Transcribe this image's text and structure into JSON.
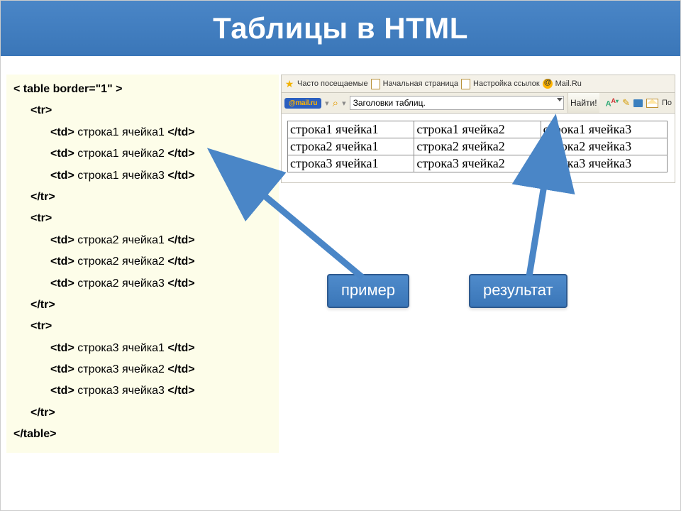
{
  "title": "Таблицы в HTML",
  "code": {
    "open_table": "< table border=\"1\" >",
    "open_tr": "<tr>",
    "close_tr": "</tr>",
    "open_td": "<td>",
    "close_td": "</td>",
    "cells": {
      "r1c1": "строка1 ячейка1",
      "r1c2": "строка1 ячейка2",
      "r1c3": "строка1 ячейка3",
      "r2c1": "строка2 ячейка1",
      "r2c2": "строка2 ячейка2",
      "r2c3": "строка2 ячейка3",
      "r3c1": "строка3 ячейка1",
      "r3c2": "строка3 ячейка2",
      "r3c3": "строка3 ячейка3"
    },
    "close_table": "</table>"
  },
  "toolbar": {
    "frequent": "Часто посещаемые",
    "startpage": "Начальная страница",
    "links": "Настройка ссылок",
    "mailru": "Mail.Ru"
  },
  "searchbar": {
    "badge": "@mail.ru",
    "field_value": "Заголовки таблиц.",
    "find": "Найти!",
    "aa": "A",
    "aa_sup": "A",
    "po": "По"
  },
  "result": {
    "rows": [
      [
        "строка1 ячейка1",
        "строка1 ячейка2",
        "строка1 ячейка3"
      ],
      [
        "строка2 ячейка1",
        "строка2 ячейка2",
        "строка2 ячейка3"
      ],
      [
        "строка3 ячейка1",
        "строка3 ячейка2",
        "строка3 ячейка3"
      ]
    ]
  },
  "callouts": {
    "primer": "пример",
    "result": "результат"
  }
}
